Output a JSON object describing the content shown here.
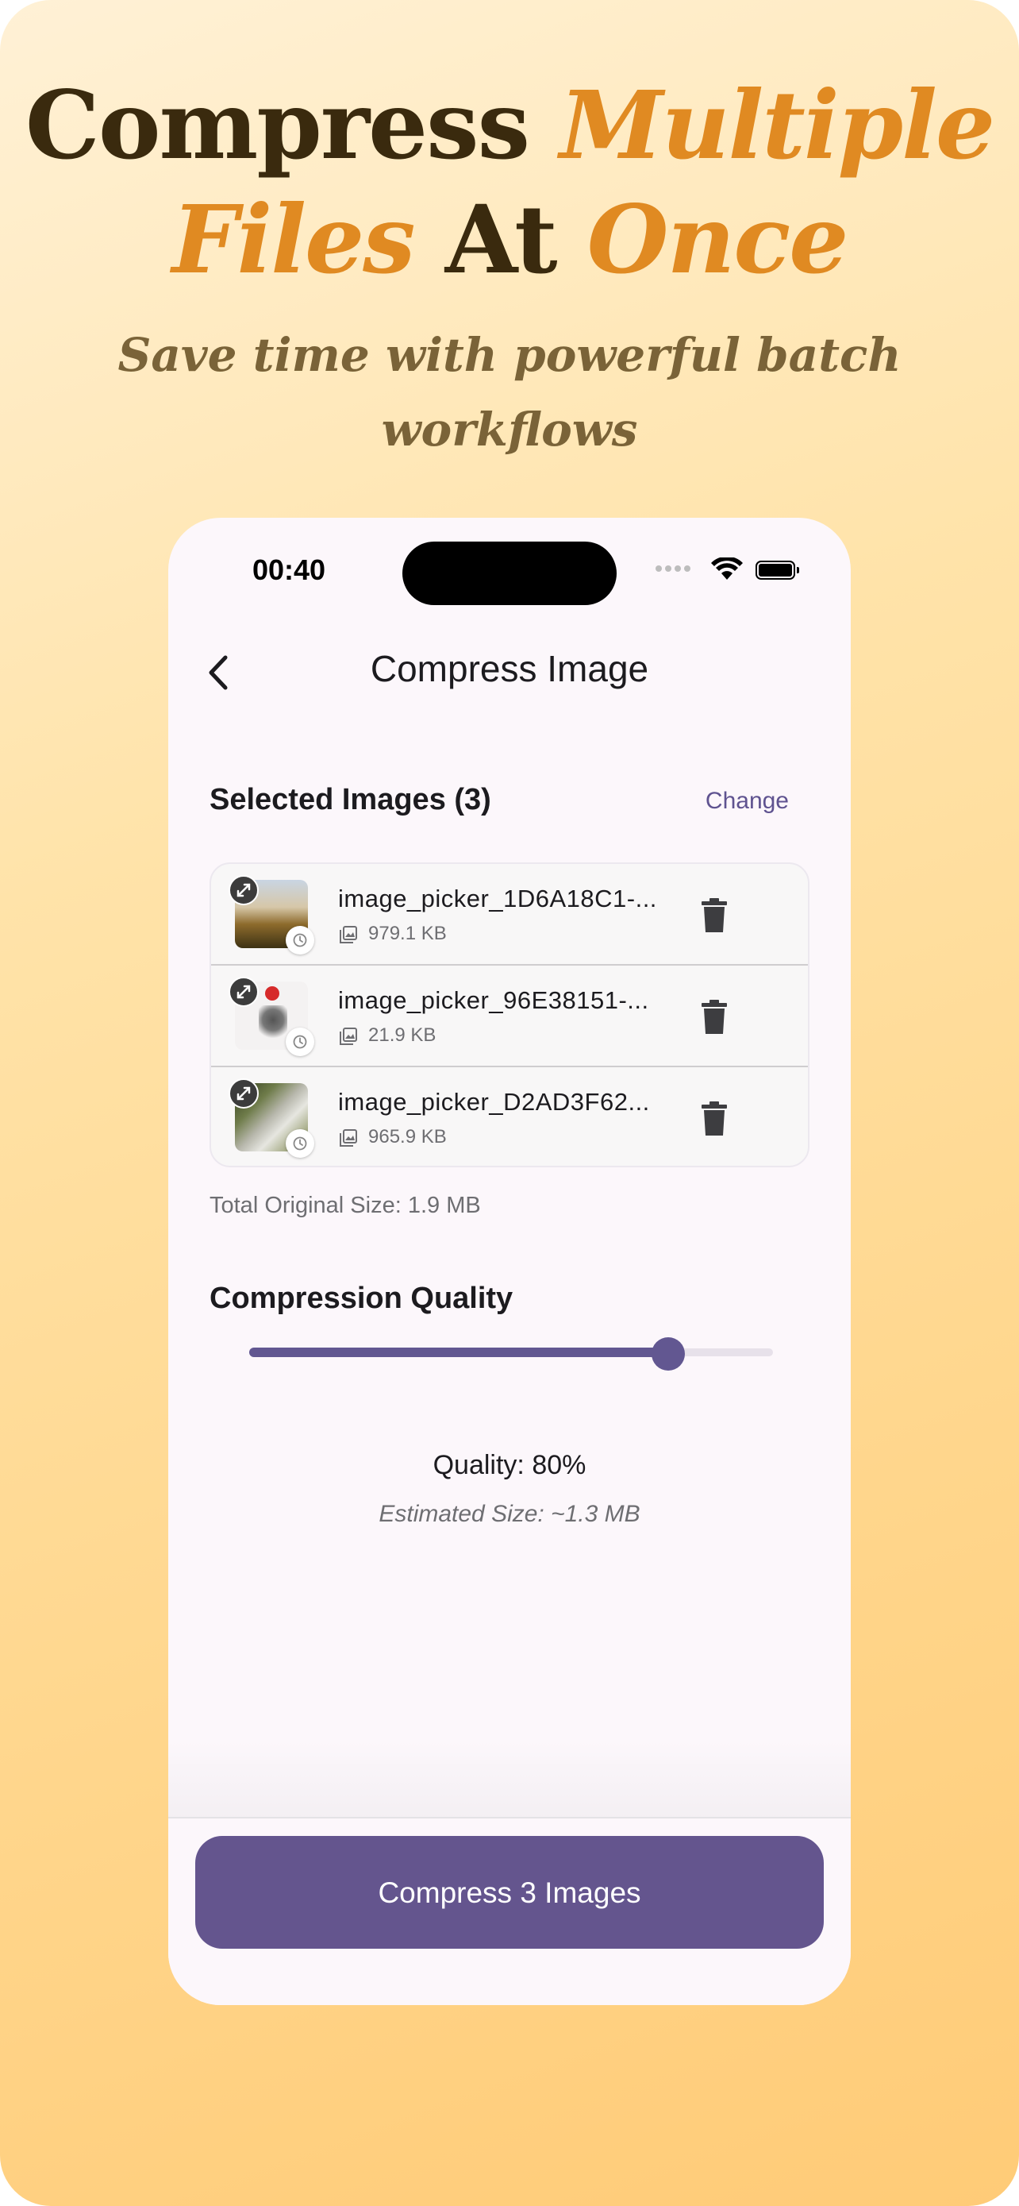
{
  "promo": {
    "headline_line1_part1": "Compress",
    "headline_line1_part2": "Multiple",
    "headline_line2_part1": "Files",
    "headline_line2_part2": "At",
    "headline_line2_part3": "Once",
    "subtitle": "Save time with powerful batch workflows",
    "colors": {
      "headline": "#3a2a0e",
      "accent": "#e08a22",
      "subtitle": "#7a6338"
    }
  },
  "status_bar": {
    "time": "00:40",
    "icons": [
      "signal-dots-icon",
      "wifi-icon",
      "battery-icon"
    ]
  },
  "app_bar": {
    "back_icon": "chevron-left-icon",
    "title": "Compress Image"
  },
  "selected": {
    "title": "Selected Images (3)",
    "change_label": "Change",
    "files": [
      {
        "name": "image_picker_1D6A18C1-...",
        "size": "979.1 KB"
      },
      {
        "name": "image_picker_96E38151-...",
        "size": "21.9 KB"
      },
      {
        "name": "image_picker_D2AD3F62...",
        "size": "965.9 KB"
      }
    ],
    "total": "Total Original Size: 1.9 MB"
  },
  "compression": {
    "title": "Compression Quality",
    "slider_value": 0.8,
    "quality_label": "Quality: 80%",
    "estimated": "Estimated Size: ~1.3 MB"
  },
  "action": {
    "compress_label": "Compress 3 Images",
    "color": "#64558e"
  }
}
